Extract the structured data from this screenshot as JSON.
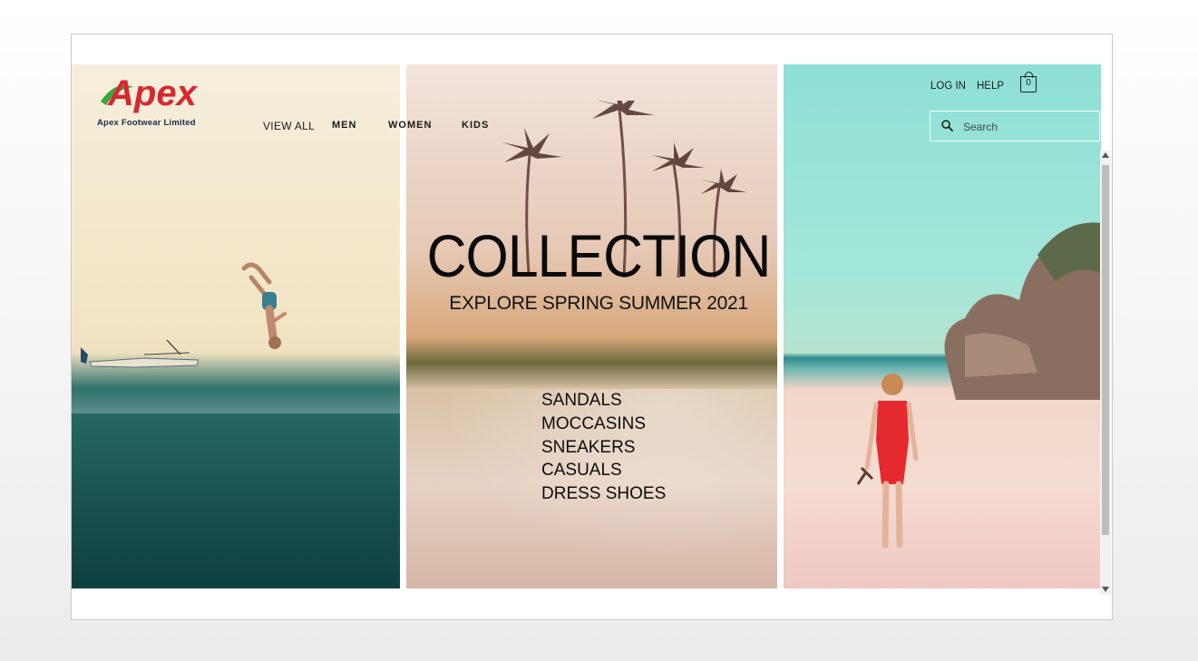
{
  "brand": {
    "logo_word": "Apex",
    "logo_sub": "Apex Footwear Limited",
    "logo_color": "#d7282f",
    "logo_accent": "#3aa63a"
  },
  "nav": {
    "items": [
      {
        "label": "VIEW ALL"
      },
      {
        "label": "MEN"
      },
      {
        "label": "WOMEN"
      },
      {
        "label": "KIDS"
      }
    ]
  },
  "header": {
    "login_label": "LOG IN",
    "help_label": "HELP",
    "cart_count": "0",
    "search_placeholder": "Search"
  },
  "hero": {
    "title": "COLLECTION",
    "subtitle": "EXPLORE SPRING SUMMER 2021",
    "categories": [
      "SANDALS",
      "MOCCASINS",
      "SNEAKERS",
      "CASUALS",
      "DRESS SHOES"
    ]
  },
  "icons": {
    "search": "search-icon",
    "cart": "shopping-bag-icon"
  }
}
